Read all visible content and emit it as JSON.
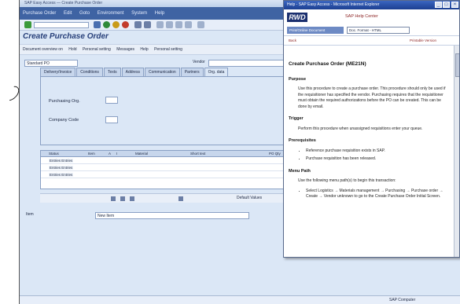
{
  "app": {
    "window_title": "SAP Easy Access — Create Purchase Order"
  },
  "menubar": {
    "items": [
      "Purchase Order",
      "Edit",
      "Goto",
      "Environment",
      "System",
      "Help"
    ]
  },
  "page": {
    "title": "Create Purchase Order"
  },
  "app_toolbar": {
    "items": [
      "Document overview on",
      "Hold",
      "Personal setting",
      "Messages",
      "Help",
      "Personal setting"
    ]
  },
  "header": {
    "po_type": "Standard PO",
    "vendor_label": "Vendor"
  },
  "tabs": [
    "Delivery/Invoice",
    "Conditions",
    "Texts",
    "Address",
    "Communication",
    "Partners",
    "Org. data"
  ],
  "org_data": {
    "purch_org_label": "Purchasing Org.",
    "company_label": "Company Code"
  },
  "grid": {
    "headers": [
      "Status",
      "Item",
      "A",
      "I",
      "Material",
      "Short text",
      "PO Qty"
    ],
    "rows": [
      "Entries Entries",
      "Entries Entries",
      "Entries Entries"
    ]
  },
  "grid_toolbar": {
    "label": "Default Values"
  },
  "item": {
    "label": "Item",
    "value": "New Item"
  },
  "statusbar": {
    "right": "SAP Computer"
  },
  "help": {
    "window_title": "Help - SAP Easy Access - Microsoft Internet Explorer",
    "logo": "RWD",
    "centre_title": "SAP Help Center",
    "tab_label": "Print/Online Document",
    "select_value": "Doc. Format - HTML",
    "link_left": "Back",
    "link_right": "Printable Version",
    "heading": "Create Purchase Order (ME21N)",
    "purpose_title": "Purpose",
    "purpose_text": "Use this procedure to create a purchase order. This procedure should only be used if the requisitioner has specified the vendor. Purchasing requires that the requisitioner must obtain the required authorizations before the PO can be created. This can be done by email.",
    "trigger_title": "Trigger",
    "trigger_text": "Perform this procedure when unassigned requisitions enter your queue.",
    "prereq_title": "Prerequisites",
    "prereq_items": [
      "Reference purchase requisition exists in SAP.",
      "Purchase requisition has been released."
    ],
    "menu_title": "Menu Path",
    "menu_text": "Use the following menu path(s) to begin this transaction:",
    "menu_item": "Select Logistics → Materials management → Purchasing → Purchase order → Create → Vendor unknown to go to the Create Purchase Order Initial Screen."
  }
}
